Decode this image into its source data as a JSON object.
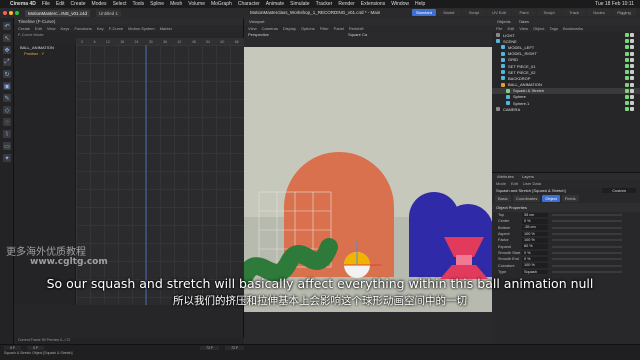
{
  "menubar": {
    "app": "Cinema 4D",
    "items": [
      "File",
      "Edit",
      "Create",
      "Modes",
      "Select",
      "Tools",
      "Spline",
      "Mesh",
      "Volume",
      "MoGraph",
      "Character",
      "Animate",
      "Simulate",
      "Tracker",
      "Render",
      "Extensions",
      "Window",
      "Help"
    ],
    "clock": "Tue 18 Feb 10:11"
  },
  "titlebar": {
    "doc_tab": "MotionMasterc...INS_v01.c4d",
    "doc_tab2": "Untitled 1",
    "window_title": "MotionMasterclass_Workshop_1_RECORDING_v01.c4d * - Main",
    "layouts": [
      "Standard",
      "Model",
      "Script",
      "UV Edit",
      "Paint",
      "Sculpt",
      "Track",
      "Nodes",
      "Rigging"
    ]
  },
  "timeline": {
    "title": "Timeline (F-Curve)",
    "menu": [
      "Create",
      "Edit",
      "View",
      "Keys",
      "Functions",
      "Key",
      "F-Curve",
      "Motion System",
      "Marker"
    ],
    "mode": "F-Curve Mode",
    "tracks": [
      {
        "label": "BALL_ANIMATION",
        "sub": false
      },
      {
        "label": "Position . Y",
        "sub": true
      }
    ],
    "ruler": [
      "0",
      "6",
      "12",
      "18",
      "24",
      "30",
      "36",
      "42",
      "48",
      "54",
      "60",
      "66"
    ],
    "status": "Current Frame 59 Preview 0-->72"
  },
  "viewport": {
    "tabs": [
      "Viewport"
    ],
    "menu": [
      "View",
      "Cameras",
      "Display",
      "Options",
      "Filter",
      "Panel",
      "Redshift"
    ],
    "left_label": "Perspective",
    "right_label": "Square Ca"
  },
  "objects": {
    "tabs": [
      "Objects",
      "Takes"
    ],
    "menu": [
      "File",
      "Edit",
      "View",
      "Object",
      "Tags",
      "Bookmarks"
    ],
    "rows": [
      {
        "label": "LIGHT",
        "indent": 0,
        "color": "#888888",
        "selected": false
      },
      {
        "label": "SCENE",
        "indent": 0,
        "color": "#55b5e0",
        "selected": false
      },
      {
        "label": "MODEL_LEFT",
        "indent": 1,
        "color": "#55b5e0",
        "selected": false
      },
      {
        "label": "MODEL_RIGHT",
        "indent": 1,
        "color": "#55b5e0",
        "selected": false
      },
      {
        "label": "GRID",
        "indent": 1,
        "color": "#55b5e0",
        "selected": false
      },
      {
        "label": "SET PIECE_01",
        "indent": 1,
        "color": "#55b5e0",
        "selected": false
      },
      {
        "label": "SET PIECE_02",
        "indent": 1,
        "color": "#55b5e0",
        "selected": false
      },
      {
        "label": "BACKDROP",
        "indent": 1,
        "color": "#55b5e0",
        "selected": false
      },
      {
        "label": "BALL_ANIMATION",
        "indent": 1,
        "color": "#e0a030",
        "selected": false
      },
      {
        "label": "Squash & Stretch",
        "indent": 2,
        "color": "#7bd67b",
        "selected": true
      },
      {
        "label": "Sphere",
        "indent": 2,
        "color": "#55b5e0",
        "selected": false
      },
      {
        "label": "Sphere.1",
        "indent": 2,
        "color": "#55b5e0",
        "selected": false
      },
      {
        "label": "CAMERA",
        "indent": 0,
        "color": "#888888",
        "selected": false
      }
    ]
  },
  "attributes": {
    "tabs": [
      "Attributes",
      "Layers"
    ],
    "menu": [
      "Mode",
      "Edit",
      "User Data"
    ],
    "object_name": "Squash and Stretch [Squash & Stretch]",
    "custom": "Custom",
    "subtabs": [
      "Basic",
      "Coordinates",
      "Object",
      "Fields"
    ],
    "active_subtab": "Object",
    "section": "Object Properties",
    "props": [
      {
        "label": "Top",
        "value": "35 cm"
      },
      {
        "label": "Center",
        "value": "0 %"
      },
      {
        "label": "Bottom",
        "value": "-35 cm"
      },
      {
        "label": "Aspect",
        "value": "100 %"
      },
      {
        "label": "Factor",
        "value": "100 %"
      },
      {
        "label": "Expand",
        "value": "60 %"
      },
      {
        "label": "Smooth Start",
        "value": "0 %"
      },
      {
        "label": "Smooth End",
        "value": "0 %"
      },
      {
        "label": "Curvature",
        "value": "100 %"
      },
      {
        "label": "Type",
        "value": "Squash"
      }
    ]
  },
  "bottom": {
    "frame_start": "0 F",
    "frame_cur": "0 F",
    "frame_end": "72 F",
    "frame_end2": "72 F",
    "status": "Squash & Stretch Object [Squash & Stretch]"
  },
  "subtitles": {
    "en": "So our squash and stretch will basically affect everything within this ball animation null",
    "zh": "所以我们的挤压和拉伸基本上会影响这个球形动画空间中的一切"
  },
  "watermark": {
    "line1": "更多海外优质教程",
    "line2": "www.cgltg.com"
  },
  "colors": {
    "accent": "#3d6fd1",
    "arch": "#d9714f",
    "blue_arch": "#2f2ba8",
    "green_worm": "#2e7a3a",
    "pink": "#e23a5c",
    "ball_top": "#f0b400"
  }
}
